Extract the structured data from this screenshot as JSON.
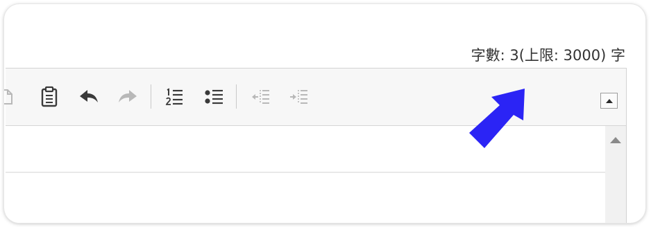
{
  "char_counter": {
    "text": "字數: 3(上限: 3000) 字"
  },
  "toolbar": {
    "buttons": [
      {
        "icon": "paste-text-icon",
        "enabled": false
      },
      {
        "icon": "clipboard-icon",
        "enabled": true
      },
      {
        "icon": "undo-icon",
        "enabled": true
      },
      {
        "icon": "redo-icon",
        "enabled": false
      },
      {
        "icon": "numbered-list-icon",
        "enabled": true
      },
      {
        "icon": "bulleted-list-icon",
        "enabled": true
      },
      {
        "icon": "decrease-indent-icon",
        "enabled": false
      },
      {
        "icon": "increase-indent-icon",
        "enabled": false
      }
    ],
    "collapse_icon": "collapse-toolbar-icon"
  },
  "colors": {
    "icon_enabled": "#3a3a3a",
    "icon_disabled": "#b8b8b8",
    "annotation_arrow": "#2b24f5",
    "toolbar_bg": "#f7f7f7",
    "border": "#d2d2d2"
  }
}
